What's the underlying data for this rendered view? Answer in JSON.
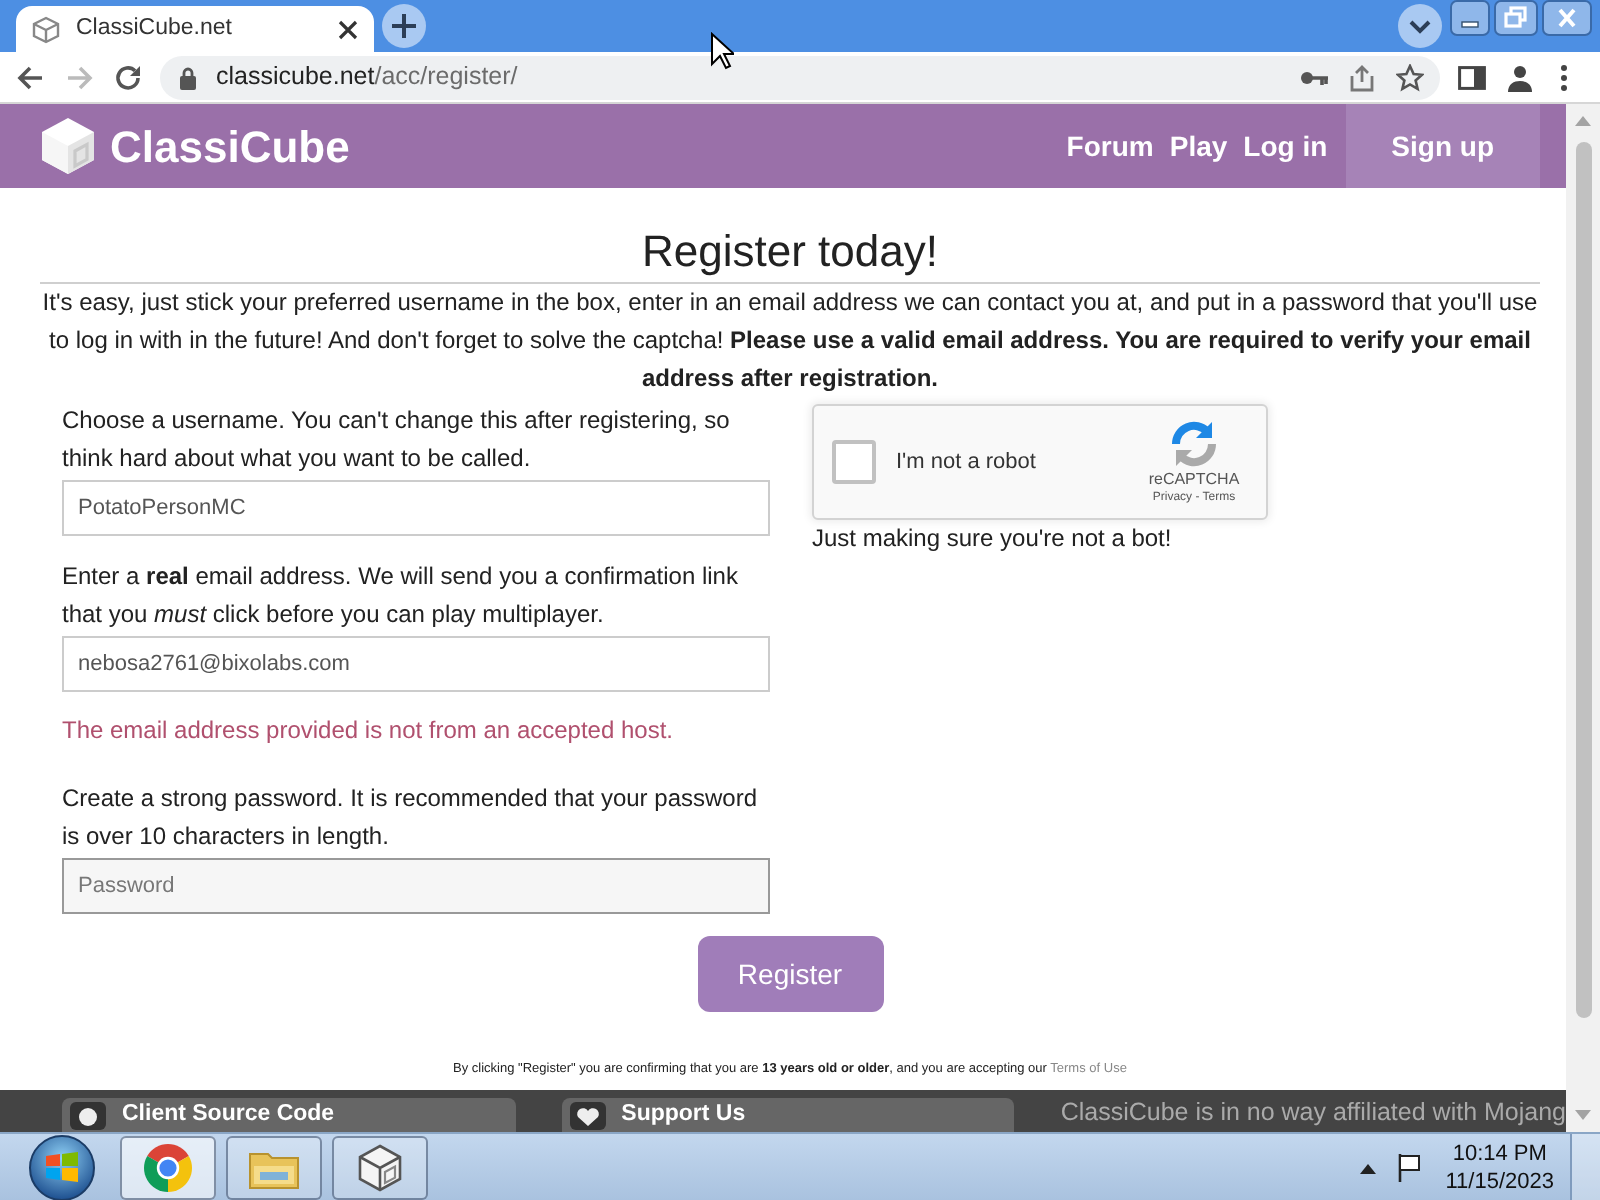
{
  "browser": {
    "tabs": [
      {
        "title": "ClassiCube.net",
        "selected": true
      }
    ],
    "address": {
      "host": "classicube.net",
      "path": "/acc/register/"
    }
  },
  "site_header": {
    "logo": "ClassiCube",
    "nav": [
      {
        "label": "Forum",
        "selected": false
      },
      {
        "label": "Play",
        "selected": false
      },
      {
        "label": "Log in",
        "selected": false
      },
      {
        "label": "Sign up",
        "selected": true
      }
    ]
  },
  "register": {
    "title": "Register today!",
    "intro": "It's easy, just stick your preferred username in the box, enter in an email address we can contact you at, and put in a password that you'll use to log in with in the future! And don't forget to solve the captcha! **Please use a valid email address. You are required to verify your email address after registration.**",
    "fields": [
      {
        "label": "Choose a username. You can't change this after registering, so think hard about what you want to be called.",
        "value": "PotatoPersonMC",
        "focused": false
      },
      {
        "label": "Enter a **real** email address. We will send you a confirmation link that you *must* click before you can play multiplayer.",
        "value": "nebosa2761@bixolabs.com",
        "error": "The email address provided is not from an accepted host.",
        "focused": false
      },
      {
        "label": "Create a strong password. It is recommended that your password is over 10 characters in length.",
        "placeholder": "Password",
        "focused": true
      }
    ],
    "captcha": {
      "label": "I'm not a robot",
      "checked": false,
      "brand": "reCAPTCHA",
      "links": "Privacy - Terms",
      "note": "Just making sure you're not a bot!"
    },
    "submit": "Register",
    "disclaimer": "By clicking \"Register\" you are confirming that you are **13 years old or older**, and you are accepting our",
    "terms_link": "Terms of Use"
  },
  "footer": {
    "buttons": [
      {
        "label": "Client Source Code",
        "kind": "code"
      },
      {
        "label": "Support Us",
        "kind": "heart"
      }
    ],
    "note": "ClassiCube is in no way affiliated with Mojang"
  },
  "taskbar": {
    "apps": [
      {
        "kind": "browser",
        "selected": true
      },
      {
        "kind": "folder",
        "selected": false
      },
      {
        "kind": "cube",
        "selected": false
      }
    ],
    "time": "10:14 PM",
    "date": "11/15/2023"
  }
}
